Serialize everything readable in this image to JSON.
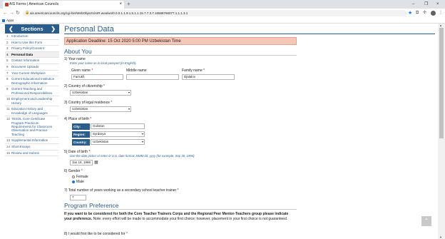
{
  "browser": {
    "tab_title": "AIS Forms | American Councils",
    "tab_close": "×",
    "new_tab": "+",
    "window_controls": [
      "–",
      "❐",
      "×"
    ],
    "url": "ais.americancouncils.org/cgi-bin/WebObjects/AIR.woa/wo/0.0.0.1.1.9.1.5.1.1.15.7.7.3.7.16568766077.1.1.1.3.1",
    "bookmarks_apps": "Apps"
  },
  "sidebar": {
    "title": "Sections",
    "prev": "❮",
    "next": "❯",
    "items": [
      {
        "num": "1",
        "label": "Introduction"
      },
      {
        "num": "2",
        "label": "How to Use this Form"
      },
      {
        "num": "3",
        "label": "Privacy Policy/Consent"
      },
      {
        "num": "4",
        "label": "Personal Data"
      },
      {
        "num": "5",
        "label": "Contact Information"
      },
      {
        "num": "6",
        "label": "Document Uploads"
      },
      {
        "num": "7",
        "label": "Your Current Workplace"
      },
      {
        "num": "8",
        "label": "Current Educational Institution Demographic Information"
      },
      {
        "num": "9",
        "label": "Current Teaching and Professional Responsibilities"
      },
      {
        "num": "10",
        "label": "Employment and Leadership History"
      },
      {
        "num": "11",
        "label": "Education History and Knowledge of Languages"
      },
      {
        "num": "12",
        "label": "TESOL Core Certificate Program Practicum Requirements for Classroom Observation and Practice Teaching"
      },
      {
        "num": "13",
        "label": "Supplemental Information"
      },
      {
        "num": "14",
        "label": "Short Essays"
      },
      {
        "num": "15",
        "label": "Review and Submit"
      }
    ]
  },
  "main": {
    "page_title": "Personal Data",
    "deadline": "Application Deadline: 15 Oct 2020 5:00 PM Uzbekistan Time",
    "about_heading": "About You",
    "q1": {
      "label": "1) Your name",
      "hint": "Enter your name as in local passport (in English).",
      "given_label": "Given name",
      "given_value": "Farrukh",
      "middle_label": "Middle name",
      "middle_value": "",
      "family_label": "Family name",
      "family_value": "Djalalov"
    },
    "q2": {
      "label": "2) Country of citizenship",
      "value": "Uzbekistan"
    },
    "q3": {
      "label": "3) Country of legal residence",
      "value": "Uzbekistan"
    },
    "q4": {
      "label": "4) Place of birth",
      "city_label": "City:",
      "city_value": "Gulistan",
      "region_label": "Region:",
      "region_value": "Syrdarya",
      "country_label": "Country:",
      "country_value": "Uzbekistan"
    },
    "q5": {
      "label": "5) Date of birth",
      "hint": "Use the date picker or enter in U.S. date format: MMM dd, yyyy (for example, Sep 30, 1994)",
      "value": "Jan 16, 1986"
    },
    "q6": {
      "label": "6) Gender",
      "female": "Female",
      "male": "Male",
      "selected": "Male"
    },
    "q7": {
      "label": "7) Total number of years working as a secondary school teacher trainer",
      "value": "7"
    },
    "program_heading": "Program Preference",
    "program_bold": "If you want to be considered for both the Core Teacher Trainers Corps and the Regional Peer Mentor-Teachers group please indicate your preference.",
    "program_note": " Note: every effort will be made to accommodate your first choice; however, placement in your first choice is not guaranteed.",
    "q8": {
      "label": "8) I would first like to be considered for"
    },
    "required_mark": "*"
  },
  "colors": {
    "accent": "#2b5d8c",
    "deadline_bg": "#f4c7b6",
    "required": "#cc0000"
  }
}
